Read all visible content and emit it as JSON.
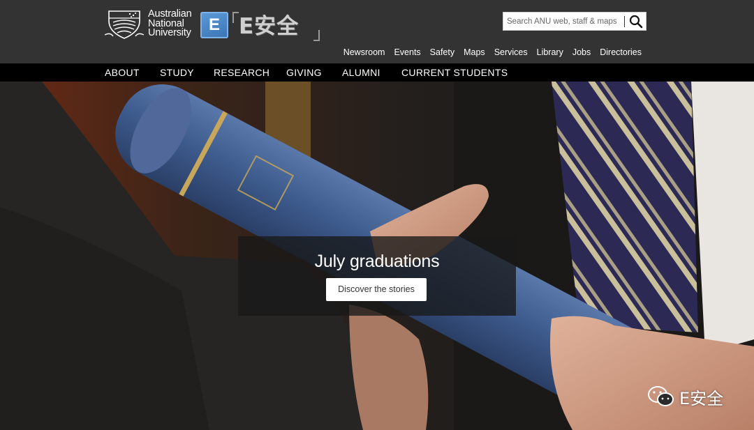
{
  "header": {
    "university_name": [
      "Australian",
      "National",
      "University"
    ],
    "partner_badge_letter": "E",
    "partner_wordmark": "E安全",
    "search": {
      "placeholder": "Search ANU web, staff & maps"
    },
    "utility_links": [
      "Newsroom",
      "Events",
      "Safety",
      "Maps",
      "Services",
      "Library",
      "Jobs",
      "Directories"
    ]
  },
  "main_nav": {
    "items": [
      "ABOUT",
      "STUDY",
      "RESEARCH",
      "GIVING",
      "ALUMNI",
      "CURRENT STUDENTS"
    ]
  },
  "hero": {
    "title": "July graduations",
    "button_label": "Discover the stories"
  },
  "watermark": {
    "text": "E安全"
  },
  "colors": {
    "header_bg": "#333333",
    "nav_bg": "#000000",
    "scroll_blue": "#3d5a8c",
    "badge_blue": "#3a74b5"
  }
}
